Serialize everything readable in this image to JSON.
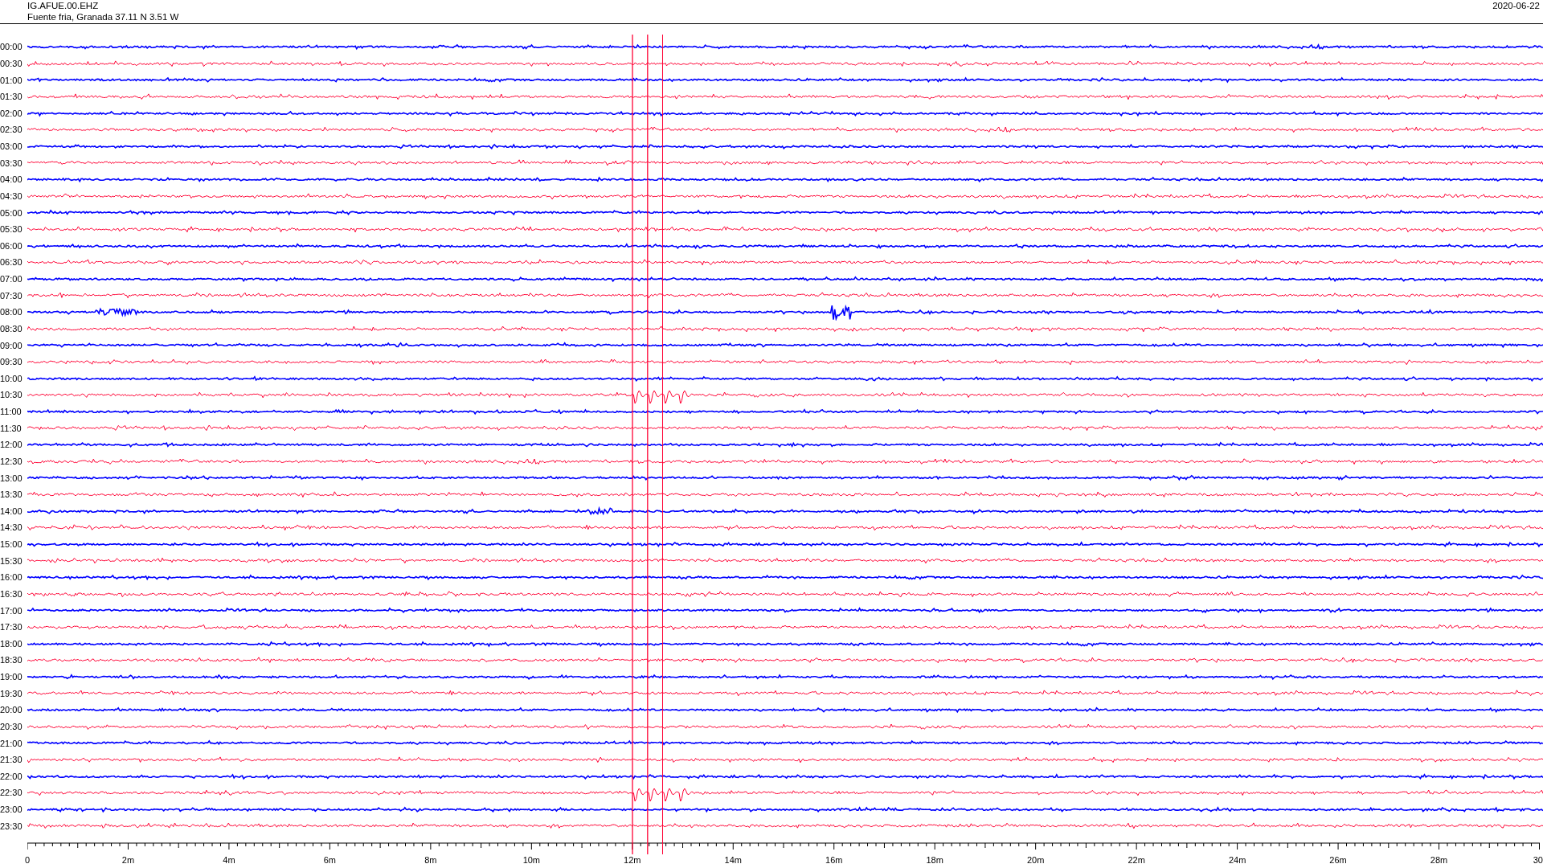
{
  "header": {
    "station": "IG.AFUE.00.EHZ",
    "location": "Fuente fria, Granada  37.11 N 3.51 W",
    "date": "2020-06-22"
  },
  "traces": [
    {
      "label": "00:00",
      "color": "#0000ff"
    },
    {
      "label": "00:30",
      "color": "#ff0033"
    },
    {
      "label": "01:00",
      "color": "#0000ff"
    },
    {
      "label": "01:30",
      "color": "#ff0033"
    },
    {
      "label": "02:00",
      "color": "#0000ff"
    },
    {
      "label": "02:30",
      "color": "#ff0033"
    },
    {
      "label": "03:00",
      "color": "#0000ff"
    },
    {
      "label": "03:30",
      "color": "#ff0033"
    },
    {
      "label": "04:00",
      "color": "#0000ff"
    },
    {
      "label": "04:30",
      "color": "#ff0033"
    },
    {
      "label": "05:00",
      "color": "#0000ff"
    },
    {
      "label": "05:30",
      "color": "#ff0033"
    },
    {
      "label": "06:00",
      "color": "#0000ff"
    },
    {
      "label": "06:30",
      "color": "#ff0033"
    },
    {
      "label": "07:00",
      "color": "#0000ff"
    },
    {
      "label": "07:30",
      "color": "#ff0033"
    },
    {
      "label": "08:00",
      "color": "#0000ff"
    },
    {
      "label": "08:30",
      "color": "#ff0033"
    },
    {
      "label": "09:00",
      "color": "#0000ff"
    },
    {
      "label": "09:30",
      "color": "#ff0033"
    },
    {
      "label": "10:00",
      "color": "#0000ff"
    },
    {
      "label": "10:30",
      "color": "#ff0033"
    },
    {
      "label": "11:00",
      "color": "#0000ff"
    },
    {
      "label": "11:30",
      "color": "#ff0033"
    },
    {
      "label": "12:00",
      "color": "#0000ff"
    },
    {
      "label": "12:30",
      "color": "#ff0033"
    },
    {
      "label": "13:00",
      "color": "#0000ff"
    },
    {
      "label": "13:30",
      "color": "#ff0033"
    },
    {
      "label": "14:00",
      "color": "#0000ff"
    },
    {
      "label": "14:30",
      "color": "#ff0033"
    },
    {
      "label": "15:00",
      "color": "#0000ff"
    },
    {
      "label": "15:30",
      "color": "#ff0033"
    },
    {
      "label": "16:00",
      "color": "#0000ff"
    },
    {
      "label": "16:30",
      "color": "#ff0033"
    },
    {
      "label": "17:00",
      "color": "#0000ff"
    },
    {
      "label": "17:30",
      "color": "#ff0033"
    },
    {
      "label": "18:00",
      "color": "#0000ff"
    },
    {
      "label": "18:30",
      "color": "#ff0033"
    },
    {
      "label": "19:00",
      "color": "#0000ff"
    },
    {
      "label": "19:30",
      "color": "#ff0033"
    },
    {
      "label": "20:00",
      "color": "#0000ff"
    },
    {
      "label": "20:30",
      "color": "#ff0033"
    },
    {
      "label": "21:00",
      "color": "#0000ff"
    },
    {
      "label": "21:30",
      "color": "#ff0033"
    },
    {
      "label": "22:00",
      "color": "#0000ff"
    },
    {
      "label": "22:30",
      "color": "#ff0033"
    },
    {
      "label": "23:00",
      "color": "#0000ff"
    },
    {
      "label": "23:30",
      "color": "#ff0033"
    }
  ],
  "x_axis": {
    "labels": [
      "0",
      "2m",
      "4m",
      "6m",
      "8m",
      "10m",
      "12m",
      "14m",
      "16m",
      "18m",
      "20m",
      "22m",
      "24m",
      "26m",
      "28m",
      "30"
    ]
  }
}
